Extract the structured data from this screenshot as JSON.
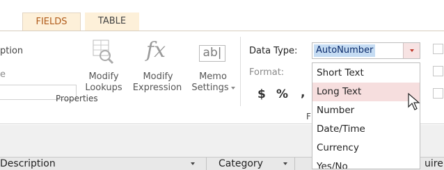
{
  "tabs": [
    {
      "label": "FIELDS"
    },
    {
      "label": "TABLE"
    }
  ],
  "properties": {
    "partial_caption": "ption",
    "partial_name": "e",
    "buttons": [
      {
        "line1": "Modify",
        "line2": "Lookups"
      },
      {
        "line1": "Modify",
        "line2": "Expression"
      },
      {
        "line1": "Memo",
        "line2": "Settings"
      }
    ],
    "group_label": "Properties",
    "memo_icon_text": "ab|",
    "fx_icon_text": "fx"
  },
  "formatting": {
    "data_type_label": "Data Type:",
    "data_type_value": "AutoNumber",
    "format_label": "Format:",
    "currency_symbol": "$",
    "percent_symbol": "%",
    "comma_symbol": ",",
    "group_label_partial": "F"
  },
  "dropdown_options": [
    {
      "label": "Short Text"
    },
    {
      "label": "Long Text"
    },
    {
      "label": "Number"
    },
    {
      "label": "Date/Time"
    },
    {
      "label": "Currency"
    },
    {
      "label": "Yes/No"
    }
  ],
  "highlighted_option": "Long Text",
  "columns": [
    {
      "label": "Description"
    },
    {
      "label": "Category"
    },
    {
      "label": "uire"
    }
  ],
  "colors": {
    "accent_tab_text": "#b05b1a",
    "tab_bg": "#fdf0d9",
    "selection_bg": "#c5dcf3",
    "hover_bg": "#f6dede",
    "dropdown_arrow": "#c0392b"
  }
}
